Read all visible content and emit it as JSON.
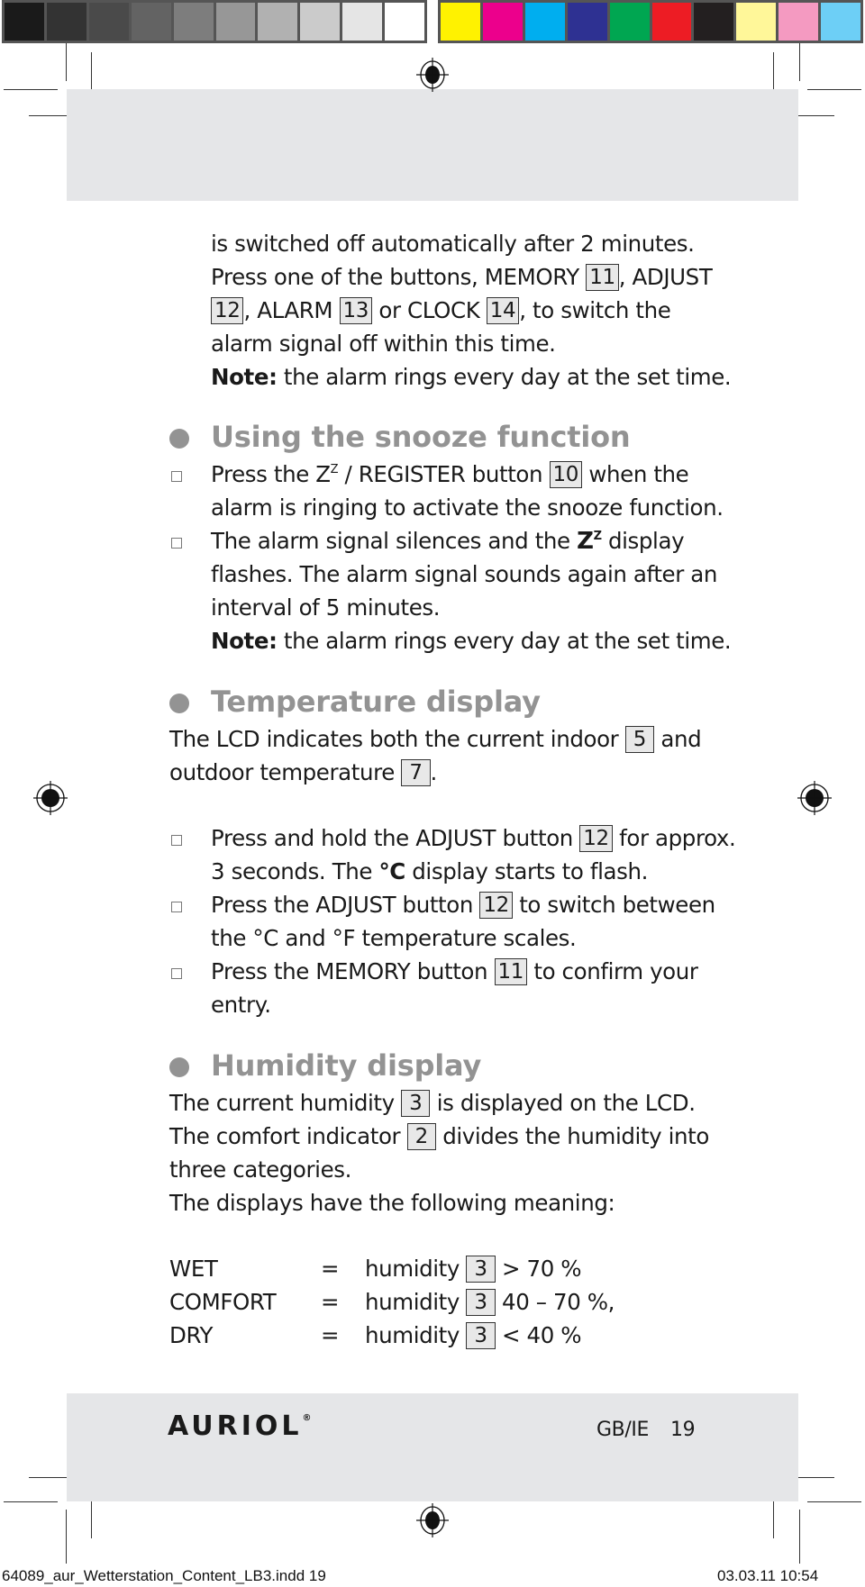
{
  "color_bar": {
    "greys": [
      "#1a1a1a",
      "#333333",
      "#4a4a4a",
      "#636363",
      "#7d7d7d",
      "#979797",
      "#b1b1b1",
      "#cbcbcb",
      "#e5e5e5",
      "#ffffff"
    ],
    "colors": [
      "#fff200",
      "#ec008c",
      "#00aeef",
      "#2e3192",
      "#00a651",
      "#ed1c24",
      "#231f20",
      "#fff799",
      "#f49ac1",
      "#6dcff6"
    ]
  },
  "intro": {
    "lines": [
      "is switched off automatically after 2 minutes.",
      "Press one of the buttons, MEMORY",
      ", ADJUST",
      ", ALARM",
      "or CLOCK",
      ", to switch the",
      "alarm signal off within this time."
    ],
    "refs": [
      "11",
      "12",
      "13",
      "14"
    ],
    "note_label": "Note:",
    "note_text": " the alarm rings every day at the set time."
  },
  "snooze": {
    "heading": "Using the snooze function",
    "b1_a": "Press the Z",
    "b1_sup": "Z",
    "b1_b": " / REGISTER button ",
    "b1_ref": "10",
    "b1_c": " when the",
    "b1_line2": "alarm is ringing to activate the snooze function.",
    "b2_a": "The alarm signal silences and the ",
    "b2_zz": "Z",
    "b2_zz_sup": "Z",
    "b2_b": " display",
    "b2_line2": "flashes. The alarm signal sounds again after an",
    "b2_line3": "interval of 5 minutes.",
    "note_label": "Note:",
    "note_text": " the alarm rings every day at the set time."
  },
  "temperature": {
    "heading": "Temperature display",
    "p1_a": "The LCD indicates both the current indoor ",
    "p1_ref": "5",
    "p1_b": " and",
    "p2_a": "outdoor temperature ",
    "p2_ref": "7",
    "p2_b": ".",
    "b1_a": "Press and hold the ADJUST button ",
    "b1_ref": "12",
    "b1_b": " for approx.",
    "b1_line2_a": "3 seconds. The ",
    "b1_line2_sym": "°C",
    "b1_line2_b": " display starts to flash.",
    "b2_a": "Press the ADJUST button ",
    "b2_ref": "12",
    "b2_b": " to switch between",
    "b2_line2": "the °C and °F temperature scales.",
    "b3_a": "Press the MEMORY button ",
    "b3_ref": "11",
    "b3_b": " to confirm your",
    "b3_line2": "entry."
  },
  "humidity": {
    "heading": "Humidity display",
    "p1_a": "The current humidity ",
    "p1_ref": "3",
    "p1_b": " is displayed on the LCD.",
    "p2_a": "The comfort indicator ",
    "p2_ref": "2",
    "p2_b": " divides the humidity into",
    "p3": "three categories.",
    "p4": "The displays have the following meaning:",
    "table": [
      {
        "label": "WET",
        "eq": "=",
        "word": "humidity",
        "ref": "3",
        "value": "> 70 %"
      },
      {
        "label": "COMFORT",
        "eq": "=",
        "word": "humidity",
        "ref": "3",
        "value": "40 – 70 %,"
      },
      {
        "label": "DRY",
        "eq": "=",
        "word": "humidity",
        "ref": "3",
        "value": "< 40 %"
      }
    ]
  },
  "footer": {
    "brand": "AURIOL",
    "registered": "®",
    "locale": "GB/IE",
    "page": "19"
  },
  "slug": {
    "file": "64089_aur_Wetterstation_Content_LB3.indd   19",
    "datetime": "03.03.11   10:54"
  }
}
